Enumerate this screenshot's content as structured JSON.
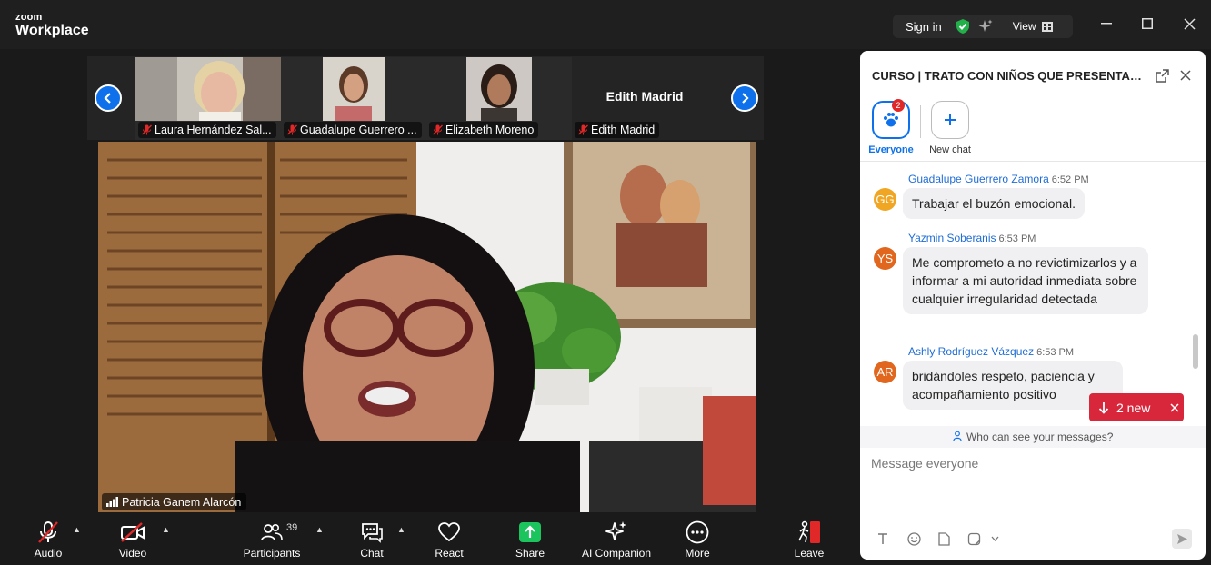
{
  "app": {
    "brand_top": "zoom",
    "brand_bottom": "Workplace"
  },
  "titlebar": {
    "sign_in": "Sign in",
    "view": "View"
  },
  "gallery": {
    "participants": [
      {
        "name": "Laura Hernández Sal...",
        "muted": true
      },
      {
        "name": "Guadalupe Guerrero ...",
        "muted": true
      },
      {
        "name": "Elizabeth Moreno",
        "muted": true
      },
      {
        "name": "Edith Madrid",
        "muted": true,
        "display_name": "Edith Madrid"
      }
    ]
  },
  "speaker": {
    "name": "Patricia Ganem Alarcón"
  },
  "toolbar": {
    "audio": "Audio",
    "video": "Video",
    "participants": "Participants",
    "participants_count": "39",
    "chat": "Chat",
    "react": "React",
    "share": "Share",
    "ai_companion": "AI Companion",
    "more": "More",
    "leave": "Leave"
  },
  "chat": {
    "title": "CURSO | TRATO CON NIÑOS QUE PRESENTAN P...",
    "channels": [
      {
        "label": "Everyone",
        "badge": "2",
        "active": true
      },
      {
        "label": "New chat"
      }
    ],
    "messages": [
      {
        "initials": "GG",
        "color": "#f0a623",
        "sender": "Guadalupe Guerrero Zamora",
        "time": "6:52 PM",
        "text": "Trabajar el buzón emocional."
      },
      {
        "initials": "YS",
        "color": "#e0671d",
        "sender": "Yazmin Soberanis",
        "time": "6:53 PM",
        "text": "Me comprometo a no revictimizarlos y a informar a mi autoridad inmediata sobre cualquier irregularidad detectada"
      },
      {
        "initials": "AR",
        "color": "#e0671d",
        "sender": "Ashly Rodríguez Vázquez",
        "time": "6:53 PM",
        "text": "bridándoles respeto, paciencia y acompañamiento positivo"
      }
    ],
    "new_messages": "2 new",
    "who_can_see": "Who can see your messages?",
    "input_placeholder": "Message everyone"
  },
  "colors": {
    "accent": "#0e71eb",
    "leave": "#e02828",
    "share": "#1bc45d",
    "new_pill": "#d8263b"
  }
}
